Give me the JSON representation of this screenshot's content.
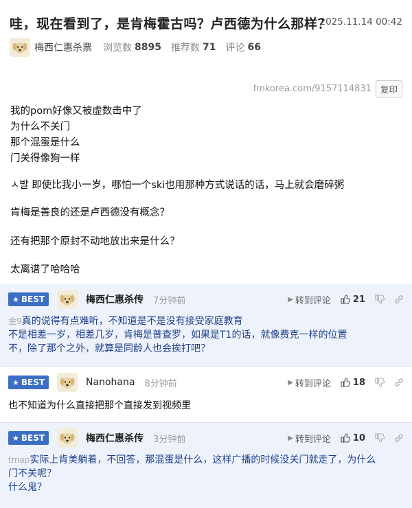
{
  "post": {
    "title": "哇，现在看到了，是肯梅霍古吗？卢西德为什么那样？",
    "date": "2025.11.14 00:42",
    "author": "梅西仁惠杀票",
    "views_label": "浏览数",
    "views": "8895",
    "recommend_label": "推荐数",
    "recommend": "71",
    "comments_label": "评论",
    "comments": "66",
    "url": "fmkorea.com/9157114831",
    "copy_label": "复印"
  },
  "article": {
    "lines": [
      "我的pom好像又被虚数击中了",
      "为什么不关门",
      "那个混蛋是什么",
      "门关得像狗一样",
      "ㅅ발 即使比我小一岁，哪怕一个ski也用那种方式说话的话，马上就会磨碎粥",
      "肯梅是善良的还是卢西德没有概念？",
      "还有把那个原封不动地放出来是什么？",
      "太离谱了哈哈哈"
    ]
  },
  "comments": [
    {
      "badge": "BEST",
      "author": "梅西仁惠杀传",
      "time": "7分钟前",
      "forward": "转到评论",
      "likes": "21",
      "ref": "金9",
      "lines": [
        "真的说得有点难听，不知道是不是没有接受家庭教育",
        "不是相差一岁，相差几岁，肯梅是普查罗，如果是T1的话，就像费克一样的位置",
        "不，除了那个之外，就算是同龄人也会挨打吧？"
      ]
    },
    {
      "badge": "BEST",
      "author": "Nanohana",
      "time": "8分钟前",
      "forward": "转到评论",
      "likes": "18",
      "ref": "",
      "lines": [
        "也不知道为什么直接把那个直接发到视频里"
      ]
    },
    {
      "badge": "BEST",
      "author": "梅西仁惠杀传",
      "time": "3分钟前",
      "forward": "转到评论",
      "likes": "10",
      "ref": "tmap",
      "lines": [
        "实际上肯美躺着，不回答，那混蛋是什么，这样广播的时候没关门就走了，为什么",
        "门不关呢？",
        "什么鬼？"
      ]
    }
  ]
}
